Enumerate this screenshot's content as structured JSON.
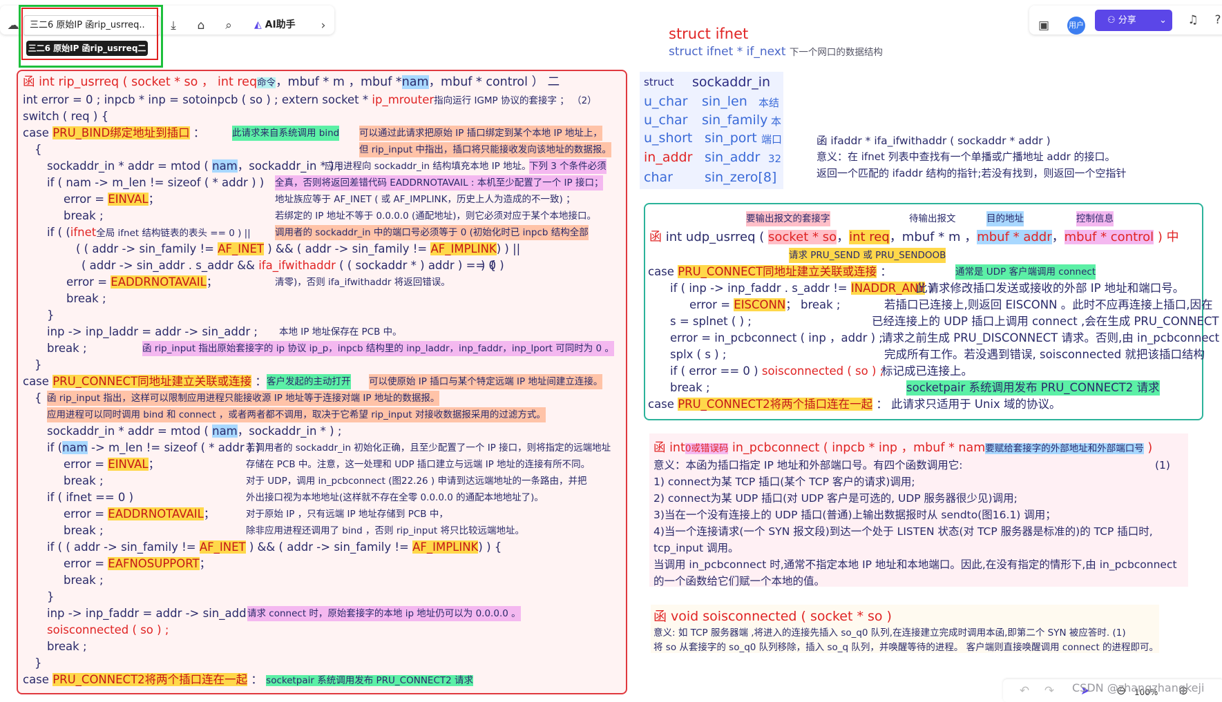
{
  "toolbar": {
    "title": "三二6 原始IP 函rip_usrreq..",
    "tooltip": "三二6 原始IP 函rip_usrreq二",
    "ai_label": "AI助手",
    "share_label": "分享"
  },
  "top_right_heading": {
    "title": "struct  ifnet",
    "subtitle": "struct ifnet * if_next",
    "subtitle_note": "下一个网口的数据结构"
  },
  "sockaddr_in": {
    "rows": [
      {
        "type": "struct",
        "name": "sockaddr_in"
      },
      {
        "type": "u_char",
        "name": "sin_len",
        "note": "本结"
      },
      {
        "type": "u_char",
        "name": "sin_family",
        "note": "本"
      },
      {
        "type": "u_short",
        "name": "sin_port",
        "note": "端口"
      },
      {
        "type": "in_addr",
        "name": "sin_addr",
        "note": "32"
      },
      {
        "type": "char",
        "name": "sin_zero[8]"
      }
    ]
  },
  "ifa_withaddr": {
    "title": "函    ifaddr * ifa_ifwithaddr ( sockaddr * addr )",
    "desc1": "意义：在 ifnet 列表中查找有一个单播或广播地址 addr 的接口。",
    "desc2": "返回一个匹配的 ifaddr 结构的指针;若没有找到，则返回一个空指针"
  },
  "rip": {
    "lines": [
      "函      int   rip_usrreq ( socket * so ， int  req",
      "命令",
      "，mbuf *  m ，mbuf *",
      "nam",
      "，mbuf * control  ）    二",
      "int error = 0 ;     inpcb * inp = sotoinpcb ( so ) ;    extern   socket * ",
      "ip_mrouter",
      "指向运行 IGMP 协议的套接字 ；  （2）",
      "switch ( req ) {",
      "case",
      "PRU_BIND绑定地址到插口",
      "：",
      "此请求来自系统调用 bind",
      "可以通过此请求把原始 IP 插口绑定到某个本地 IP 地址上，",
      "但 rip_input 中指出，插口将只能接收发向该地址的数据报。",
      "{",
      "sockaddr_in *  addr  =  mtod (",
      "nam",
      "，sockaddr_in * ) ;",
      "应用进程向 sockaddr_in 结构填充本地 IP 地址。",
      "下列 3 个条件必须",
      "if ( nam -> m_len  !=  sizeof ( * addr ) )",
      "全真，否则将返回差错代码 EADDRNOTAVAIL : 本机至少配置了一个 IP 接口；",
      "error  =",
      "EINVAL",
      "；",
      "地址族应等于 AF_INET ( 或 AF_IMPLINK，历史上人为造成的不一致) ；",
      "break ;",
      "若绑定的 IP 地址不等于 0.0.0.0 (通配地址)，则它必须对应于某个本地接口。",
      "if (      (",
      "ifnet",
      "全局 ifnet 结构链表的表头 == 0 ) ||",
      "调用者的 sockaddr_in 中的端口号必须等于 0 (初始化时已 inpcb 结构全部",
      "( ( addr -> sin_family  !=",
      "AF_INET",
      ") && ( addr -> sin_family  !=",
      "AF_IMPLINK",
      ") ) ||",
      "( addr -> sin_addr . s_addr  &&",
      "ifa_ifwithaddr",
      "( ( sockaddr * ) addr )  == 0 )",
      ") {",
      "error  =",
      "EADDRNOTAVAIL",
      "；",
      "清零)，否则 ifa_ifwithaddr 将返回错误。",
      "break ;",
      "}",
      "inp -> inp_laddr  =  addr -> sin_addr ;",
      "本地 IP 地址保存在 PCB 中。",
      "break ;",
      "函  rip_input 指出原始套接字的 ip 协议 ip_p，inpcb 结构里的 inp_laddr，inp_faddr，inp_lport 可同时为 0 。",
      "}",
      "case",
      "PRU_CONNECT同地址建立关联或连接",
      "：",
      "客户发起的主动打开",
      "可以使原始 IP 插口与某个特定远端 IP 地址间建立连接。",
      "{",
      "函 rip_input 指出，这样可以限制应用进程只能接收源 IP 地址等于连接对端 IP 地址的数据报。",
      "应用进程可以同时调用 bind 和 connect ，或者两者都不调用，取决于它希望 rip_input 对接收数据报采用的过滤方式。",
      "sockaddr_in *  addr  =  mtod (",
      "nam",
      "，sockaddr_in * ) ;",
      "if (",
      "nam",
      "-> m_len  !=  sizeof ( * addr ) )",
      "若调用者的 sockaddr_in 初始化正确，且至少配置了一个 IP 接口，则将指定的远端地址",
      "error  =",
      "EINVAL",
      "；",
      "存储在 PCB 中。注意，这一处理和 UDP 插口建立与远端 IP 地址的连接有所不同。",
      "break ;",
      "对于 UDP，调用 in_pcbconnect (图22.26 ) 申请到达远端地址的一条路由，并把",
      "if ( ifnet  == 0 )",
      "外出接口视为本地地址(这样就不存在全零 0.0.0.0 的通配本地地址了)。",
      "error  =",
      "EADDRNOTAVAIL",
      "；",
      "对于原始 IP ，只有远端 IP 地址存储到 PCB 中，",
      "break ;",
      "除非应用进程还调用了 bind ，否则 rip_input 将只比较远端地址。",
      "if ( ( addr -> sin_family  !=",
      "AF_INET",
      ") && ( addr -> sin_family  !=",
      "AF_IMPLINK",
      ") ) {",
      "error  =",
      "EAFNOSUPPORT",
      "；",
      "break ;",
      "}",
      "inp -> inp_faddr  =  addr -> sin_addr ;",
      "请求 connect 时，原始套接字的本地 ip 地址仍可以为 0.0.0.0 。",
      "soisconnected ( so ) ;",
      "break ;",
      "}",
      "case",
      "PRU_CONNECT2将两个插口连在一起",
      "：",
      "socketpair 系统调用发布 PRU_CONNECT2 请求"
    ]
  },
  "udp": {
    "labels": [
      "要输出报文的套接字",
      "待输出报文",
      "目的地址",
      "控制信息"
    ],
    "sig": [
      "函",
      "int  udp_usrreq (",
      "socket * so",
      "，",
      "int  req",
      "，mbuf  *  m ，",
      "mbuf  * addr",
      "，",
      "mbuf  * control",
      " )  中"
    ],
    "req_note": "请求 PRU_SEND 或 PRU_SENDOOB",
    "lines": [
      "case",
      "PRU_CONNECT同地址建立关联或连接",
      "：",
      "通常是 UDP 客户端调用 connect",
      "if ( inp -> inp_faddr . s_addr  !=",
      "INADDR_ANY",
      ")",
      "此请求修改插口发送或接收的外部 IP 地址和端口号。",
      "error  =",
      "EISCONN",
      "；     break ;",
      "若插口已连接上,则返回 EISCONN 。此时不应再连接上插口,因在",
      "s  =  splnet ( ) ;",
      "已经连接上的 UDP 插口上调用 connect ,会在生成 PRU_CONNECT",
      "error  =  in_pcbconnect ( inp ，addr ) ;",
      "请求之前生成 PRU_DISCONNECT 请求。否则,由 in_pcbconnect",
      "splx ( s ) ;",
      "完成所有工作。若没遇到错误, soisconnected 就把该插口结构",
      "if ( error  ==  0 )",
      "soisconnected ( so ) ;",
      "标记成已连接上。",
      "break ;",
      "socketpair 系统调用发布 PRU_CONNECT2 请求",
      "case",
      "PRU_CONNECT2将两个插口连在一起",
      "：",
      "此请求只适用于 Unix 域的协议。"
    ]
  },
  "pcbconnect": {
    "sig": [
      "函    int",
      "0或错误码",
      "   in_pcbconnect ( inpcb  *  inp ，mbuf  *  nam",
      "要赋给套接字的外部地址和外部端口号",
      " )"
    ],
    "lines": [
      "意义：本函为插口指定 IP 地址和外部端口号。有四个函数调用它:",
      "(1)",
      "1) connect为某 TCP 插口(某个 TCP 客户的请求)调用;",
      "2) connect为某 UDP 插口(对 UDP 客户是可选的, UDP 服务器很少见)调用;",
      "3)当在一个没有连接上的 UDP 插口(普通)上输出数据报时从 sendto(图16.1) 调用；",
      "4)当一个连接请求(一个 SYN 报文段)到达一个处于 LISTEN 状态(对 TCP 服务器是标准的)的 TCP 插口时,",
      "tcp_input 调用。",
      "当调用 in_pcbconnect 时,通常不指定本地 IP 地址和本地端口。因此,在没有指定的情形下,由 in_pcbconnect",
      "的一个函数给它们赋一个本地的值。"
    ]
  },
  "soisconnected": {
    "title": "函    void   soisconnected ( socket * so )",
    "lines": [
      "意义: 如 TCP 服务器端 ,将进入的连接先插入 so_q0 队列,在连接建立完成时调用本函,即第二个 SYN 被应答时.     (1)",
      "将 so 从套接字的 so_q0 队列移除，插入 so_q 队列，并唤醒等待的进程。 客户端则直接唤醒调用 connect 的进程即可。"
    ]
  },
  "watermark": "CSDN @zhangzhangkeji",
  "zoom": "100%",
  "colors": {
    "red_border": "#e0383e",
    "teal_border": "#2bb39a",
    "share_bg": "#5b46e8",
    "highlight_green": "#1dbf3c"
  }
}
